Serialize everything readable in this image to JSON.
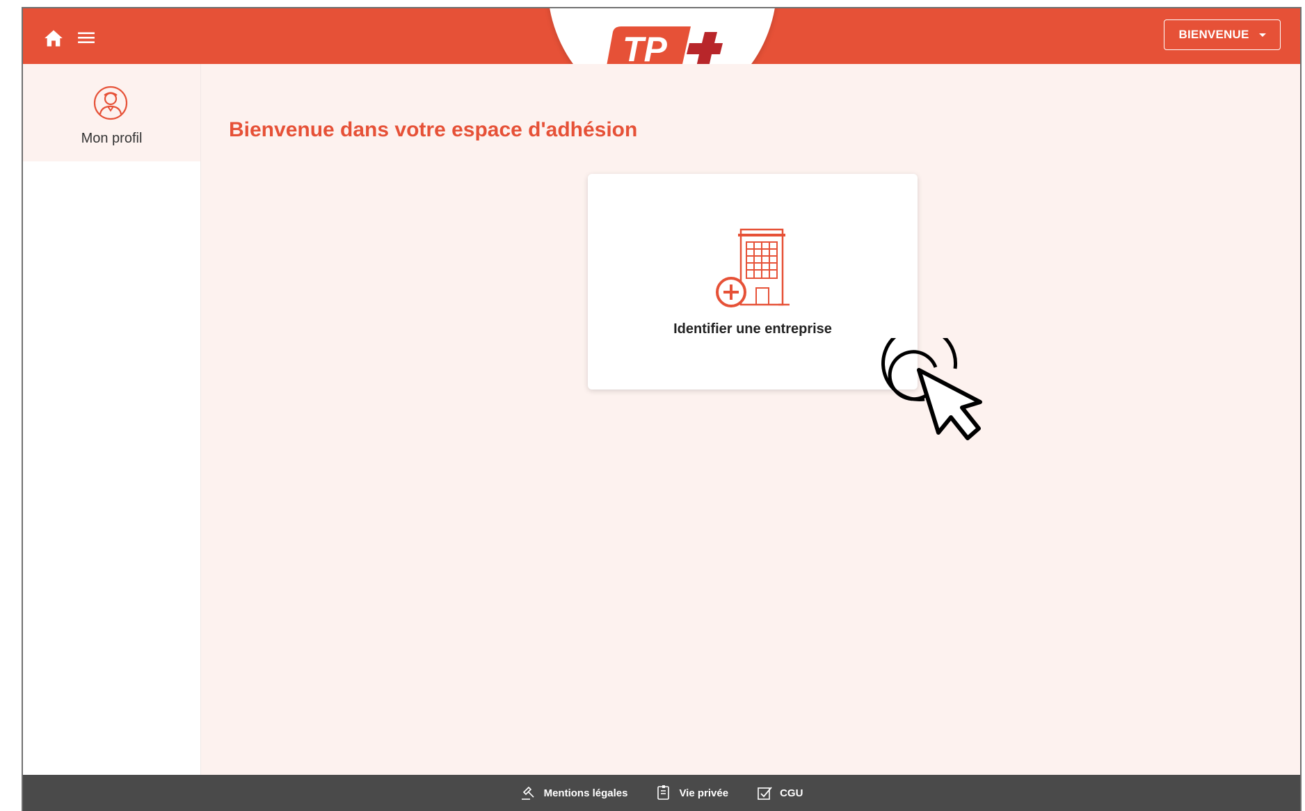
{
  "header": {
    "logo_text": "TP+",
    "welcome_button": "BIENVENUE"
  },
  "sidebar": {
    "items": [
      {
        "label": "Mon profil",
        "icon": "user-profile-icon"
      }
    ]
  },
  "main": {
    "title": "Bienvenue dans votre espace d'adhésion",
    "card": {
      "label": "Identifier une entreprise",
      "icon": "building-add-icon"
    }
  },
  "footer": {
    "links": [
      {
        "label": "Mentions légales",
        "icon": "gavel-icon"
      },
      {
        "label": "Vie privée",
        "icon": "document-icon"
      },
      {
        "label": "CGU",
        "icon": "checklist-icon"
      }
    ]
  },
  "colors": {
    "brand": "#e65137",
    "logo_dark": "#b8262a",
    "background": "#fdf2ef",
    "footer": "#4a4a4a"
  }
}
